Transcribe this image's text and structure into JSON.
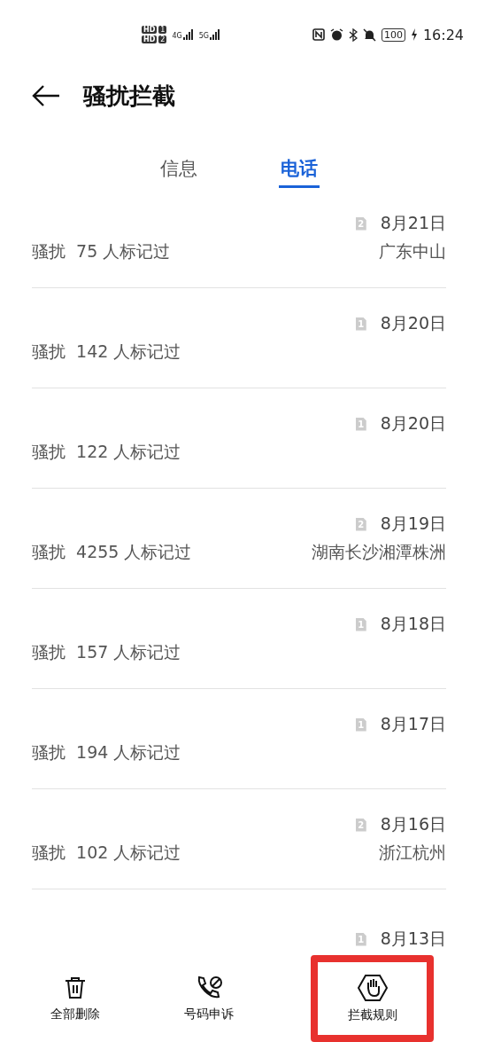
{
  "status_bar": {
    "sims": [
      {
        "badge": "HD",
        "slot": "1"
      },
      {
        "badge": "HD",
        "slot": "2"
      }
    ],
    "networks": [
      "4G",
      "5G"
    ],
    "battery": "100",
    "time": "16:24"
  },
  "header": {
    "title": "骚扰拦截"
  },
  "tabs": [
    {
      "label": "信息",
      "selected": false
    },
    {
      "label": "电话",
      "selected": true
    }
  ],
  "calls": [
    {
      "sim": "2",
      "date": "8月21日",
      "tag": "骚扰",
      "count": "75 人标记过",
      "location": "广东中山"
    },
    {
      "sim": "1",
      "date": "8月20日",
      "tag": "骚扰",
      "count": "142 人标记过"
    },
    {
      "sim": "1",
      "date": "8月20日",
      "tag": "骚扰",
      "count": "122 人标记过"
    },
    {
      "sim": "2",
      "date": "8月19日",
      "tag": "骚扰",
      "count": "4255 人标记过",
      "location": "湖南长沙湘潭株洲"
    },
    {
      "sim": "1",
      "date": "8月18日",
      "tag": "骚扰",
      "count": "157 人标记过"
    },
    {
      "sim": "1",
      "date": "8月17日",
      "tag": "骚扰",
      "count": "194 人标记过"
    },
    {
      "sim": "2",
      "date": "8月16日",
      "tag": "骚扰",
      "count": "102 人标记过",
      "location": "浙江杭州"
    },
    {
      "sim": "1",
      "date": "8月13日"
    }
  ],
  "actions": [
    {
      "kind": "delete",
      "label": "全部删除",
      "highlighted": false
    },
    {
      "kind": "appeal",
      "label": "号码申诉",
      "highlighted": false
    },
    {
      "kind": "rules",
      "label": "拦截规则",
      "highlighted": true
    }
  ]
}
